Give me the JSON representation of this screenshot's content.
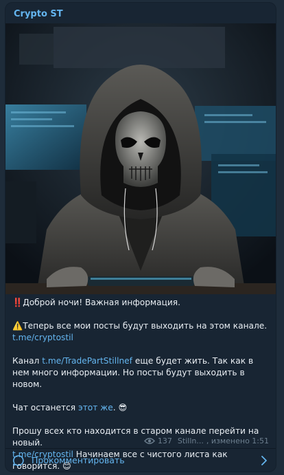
{
  "channel": {
    "name": "Crypto ST"
  },
  "message": {
    "line1": {
      "prefix": "‼️",
      "text": "Доброй ночи! Важная информация."
    },
    "line2": {
      "prefix": "⚠️",
      "text": "Теперь все мои посты будут выходить на этом канале.",
      "link": "t.me/cryptostil"
    },
    "line3": {
      "before": "Канал ",
      "link": "t.me/TradePartStillnef",
      "after": " еще будет жить. Так как в нем много информации. Но посты будут выходить в новом."
    },
    "line4": {
      "before": "Чат останется ",
      "link": "этот же",
      "after": ". 😎"
    },
    "line5": {
      "text": "Прошу всех кто находится в старом канале перейти на новый.",
      "link": "t.me/cryptostil",
      "after": " Начинаем все с чистого листа как говорится. 😊"
    }
  },
  "meta": {
    "views": "137",
    "author": "Stilln...",
    "edited": ", изменено 1:51"
  },
  "comments": {
    "label": "Прокомментировать"
  },
  "icons": {
    "views": "eye-icon",
    "comment": "comment-bubble-icon",
    "chevron": "chevron-right-icon"
  },
  "colors": {
    "accent": "#64b5ef",
    "card_bg": "#182533",
    "page_bg": "#1e2c3a"
  }
}
